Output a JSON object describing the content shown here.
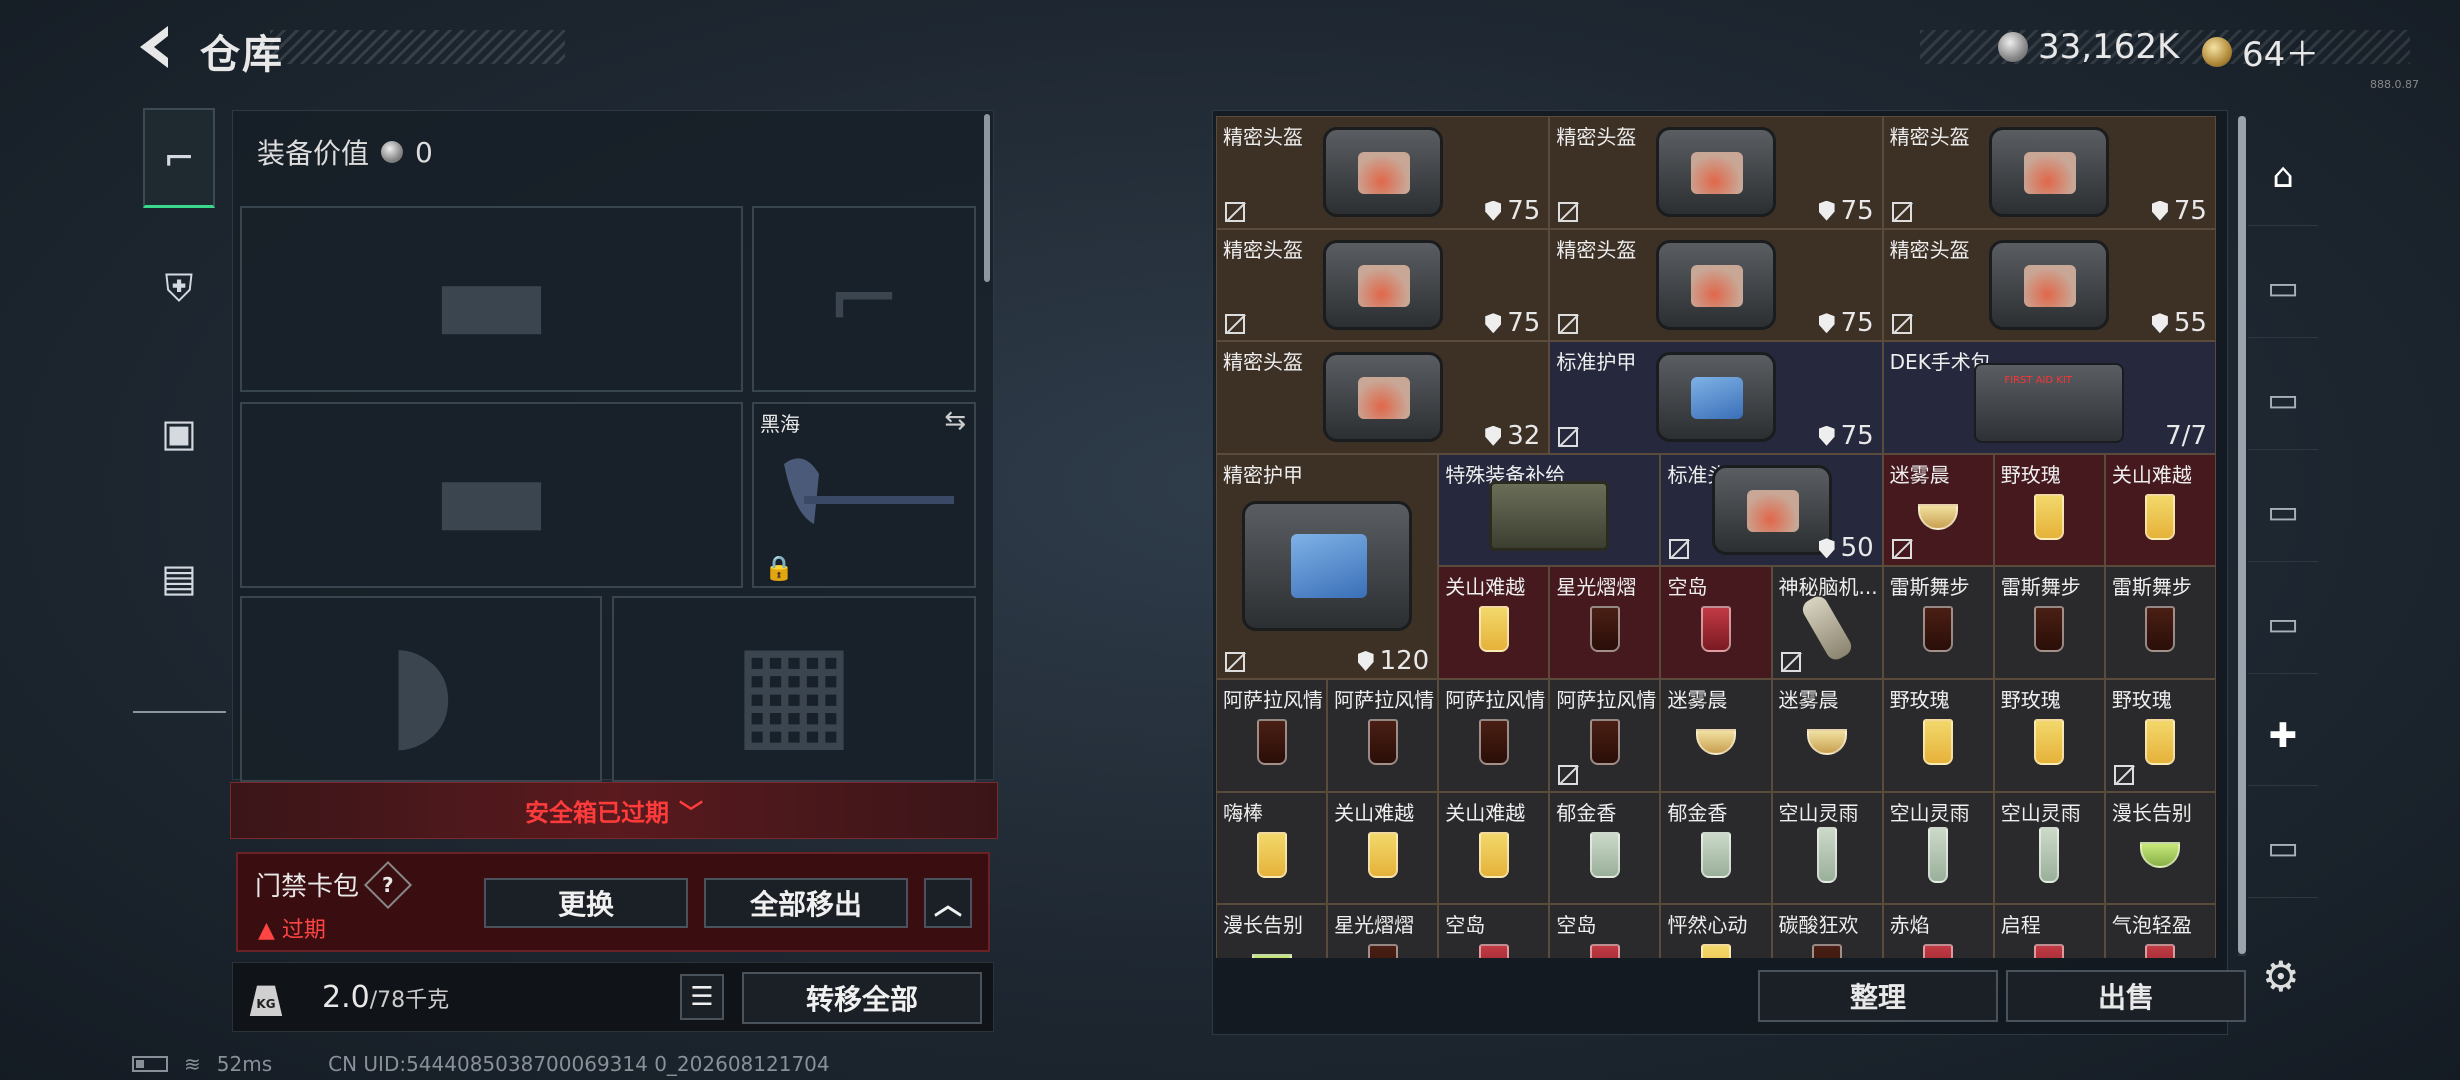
{
  "header": {
    "title": "仓库"
  },
  "currency": {
    "silver": "33,162K",
    "gold": "64＋",
    "version": "888.0.87"
  },
  "loadout": {
    "value_label": "装备价值",
    "value": "0",
    "melee_name": "黑海",
    "expired_label": "安全箱已过期",
    "keycard_title": "门禁卡包",
    "keycard_help": "?",
    "keycard_status": "过期",
    "btn_replace": "更换",
    "btn_remove_all": "全部移出",
    "weight": "2.0",
    "weight_max": "/78千克",
    "btn_transfer_all": "转移全部"
  },
  "inventory": {
    "cells": [
      {
        "name": "精密头盔",
        "durability": "75",
        "theme": "brown",
        "icon": "bag-orange",
        "lock": true
      },
      {
        "name": "精密头盔",
        "durability": "75",
        "theme": "brown",
        "icon": "bag-orange",
        "lock": true
      },
      {
        "name": "精密头盔",
        "durability": "75",
        "theme": "brown",
        "icon": "bag-orange",
        "lock": true
      },
      {
        "name": "精密头盔",
        "durability": "75",
        "theme": "brown",
        "icon": "bag-orange",
        "lock": true
      },
      {
        "name": "精密头盔",
        "durability": "75",
        "theme": "brown",
        "icon": "bag-orange",
        "lock": true
      },
      {
        "name": "精密头盔",
        "durability": "55",
        "theme": "brown",
        "icon": "bag-orange",
        "lock": true
      },
      {
        "name": "精密头盔",
        "durability": "32",
        "theme": "brown",
        "icon": "bag-orange",
        "lock": false
      },
      {
        "name": "标准护甲",
        "durability": "75",
        "theme": "blue",
        "icon": "bag-blue",
        "lock": true
      },
      {
        "name": "DEK手术包",
        "count": "7/7",
        "theme": "blue",
        "icon": "medkit",
        "lock": false
      },
      {
        "name": "精密护甲",
        "durability": "120",
        "theme": "brown",
        "icon": "bag-blue",
        "lock": true,
        "big": true
      },
      {
        "name": "特殊装备补给",
        "theme": "blue",
        "icon": "supply-box",
        "lock": false
      },
      {
        "name": "标准头盔",
        "durability": "50",
        "theme": "blue",
        "icon": "bag-orange",
        "lock": true
      },
      {
        "name": "迷雾晨",
        "theme": "red",
        "icon": "cocktail-m",
        "lock": true
      },
      {
        "name": "野玫瑰",
        "theme": "red",
        "icon": "cocktail-y",
        "lock": false
      },
      {
        "name": "关山难越",
        "theme": "red",
        "icon": "cocktail-y",
        "lock": false
      },
      {
        "name": "关山难越",
        "theme": "red",
        "icon": "cocktail-y",
        "lock": false
      },
      {
        "name": "星光熠熠",
        "theme": "red",
        "icon": "cocktail-d",
        "lock": false
      },
      {
        "name": "空岛",
        "theme": "red",
        "icon": "cocktail-r",
        "lock": false
      },
      {
        "name": "神秘脑机...",
        "theme": "dark",
        "icon": "device",
        "lock": true
      },
      {
        "name": "雷斯舞步",
        "theme": "dark",
        "icon": "cocktail-d",
        "lock": false
      },
      {
        "name": "雷斯舞步",
        "theme": "dark",
        "icon": "cocktail-d",
        "lock": false
      },
      {
        "name": "雷斯舞步",
        "theme": "dark",
        "icon": "cocktail-d",
        "lock": false
      },
      {
        "name": "阿萨拉风情",
        "theme": "dark",
        "icon": "cocktail-d",
        "lock": false
      },
      {
        "name": "阿萨拉风情",
        "theme": "dark",
        "icon": "cocktail-d",
        "lock": false
      },
      {
        "name": "阿萨拉风情",
        "theme": "dark",
        "icon": "cocktail-d",
        "lock": false
      },
      {
        "name": "阿萨拉风情",
        "theme": "dark",
        "icon": "cocktail-d",
        "lock": true
      },
      {
        "name": "迷雾晨",
        "theme": "dark",
        "icon": "cocktail-m",
        "lock": false
      },
      {
        "name": "迷雾晨",
        "theme": "dark",
        "icon": "cocktail-m",
        "lock": false
      },
      {
        "name": "野玫瑰",
        "theme": "dark",
        "icon": "cocktail-y",
        "lock": false
      },
      {
        "name": "野玫瑰",
        "theme": "dark",
        "icon": "cocktail-y",
        "lock": false
      },
      {
        "name": "野玫瑰",
        "theme": "dark",
        "icon": "cocktail-y",
        "lock": true
      },
      {
        "name": "嗨棒",
        "theme": "dark",
        "icon": "cocktail-y",
        "lock": false
      },
      {
        "name": "关山难越",
        "theme": "dark",
        "icon": "cocktail-y",
        "lock": false
      },
      {
        "name": "关山难越",
        "theme": "dark",
        "icon": "cocktail-y",
        "lock": false
      },
      {
        "name": "郁金香",
        "theme": "dark",
        "icon": "cocktail-c",
        "lock": false
      },
      {
        "name": "郁金香",
        "theme": "dark",
        "icon": "cocktail-c",
        "lock": false
      },
      {
        "name": "空山灵雨",
        "theme": "dark",
        "icon": "cocktail-tall",
        "lock": false
      },
      {
        "name": "空山灵雨",
        "theme": "dark",
        "icon": "cocktail-tall",
        "lock": false
      },
      {
        "name": "空山灵雨",
        "theme": "dark",
        "icon": "cocktail-tall",
        "lock": false
      },
      {
        "name": "漫长告别",
        "theme": "dark",
        "icon": "cocktail-g",
        "lock": false
      },
      {
        "name": "漫长告别",
        "theme": "dark",
        "icon": "cocktail-g",
        "lock": false
      },
      {
        "name": "星光熠熠",
        "theme": "dark",
        "icon": "cocktail-d",
        "lock": false
      },
      {
        "name": "空岛",
        "theme": "dark",
        "icon": "cocktail-r",
        "lock": false
      },
      {
        "name": "空岛",
        "theme": "dark",
        "icon": "cocktail-r",
        "lock": false
      },
      {
        "name": "怦然心动",
        "theme": "dark",
        "icon": "cocktail-y",
        "lock": false
      },
      {
        "name": "碳酸狂欢",
        "theme": "dark",
        "icon": "cocktail-d",
        "lock": false
      },
      {
        "name": "赤焰",
        "theme": "dark",
        "icon": "cocktail-r",
        "lock": false
      },
      {
        "name": "启程",
        "theme": "dark",
        "icon": "cocktail-r",
        "lock": false
      },
      {
        "name": "气泡轻盈",
        "theme": "dark",
        "icon": "cocktail-r",
        "lock": false
      }
    ],
    "btn_sort": "整理",
    "btn_sell": "出售"
  },
  "status": {
    "ping": "52ms",
    "uid": "CN UID:5444085038700069314 0_202608121704"
  }
}
